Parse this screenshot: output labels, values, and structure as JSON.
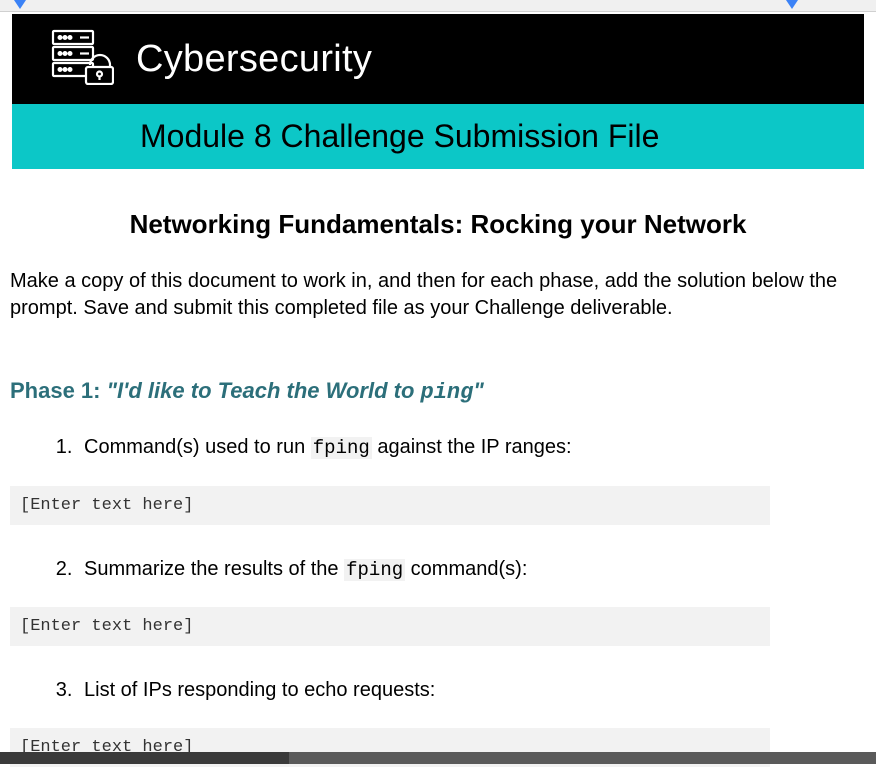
{
  "header": {
    "title": "Cybersecurity",
    "subtitle": "Module 8 Challenge Submission File"
  },
  "doc_title": "Networking Fundamentals: Rocking your Network",
  "intro": "Make a copy of this document to work in, and then for each phase, add the solution below the prompt. Save and submit this completed file as your Challenge deliverable.",
  "phase1": {
    "label": "Phase 1: ",
    "quote_open": "\"I'd like to Teach the World to ",
    "code": "ping",
    "quote_close": "\"",
    "q1_pre": "Command(s) used to run ",
    "q1_code": "fping",
    "q1_post": " against the IP ranges:",
    "q2_pre": "Summarize the results of the ",
    "q2_code": "fping",
    "q2_post": " command(s):",
    "q3": "List of IPs responding to echo requests:",
    "placeholder": "[Enter text here]"
  }
}
